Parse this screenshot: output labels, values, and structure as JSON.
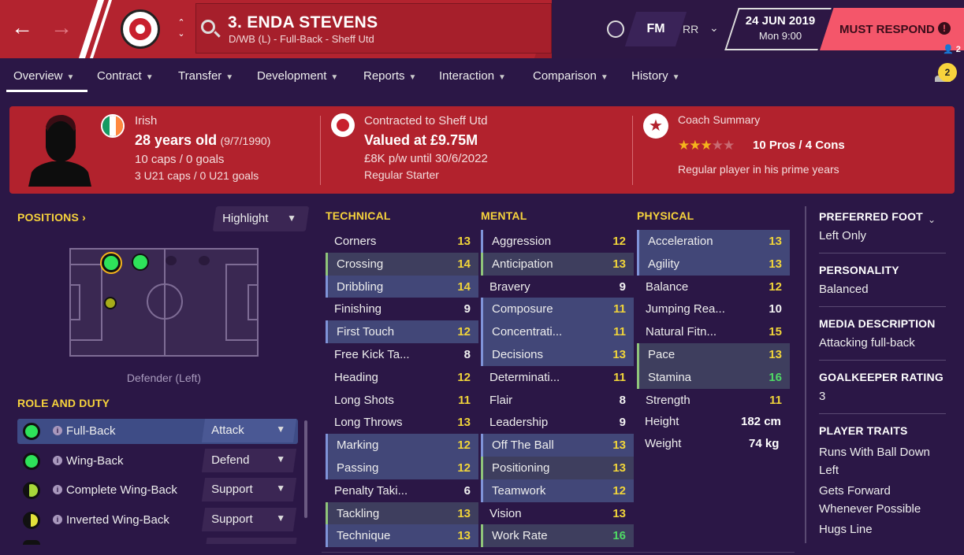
{
  "header": {
    "player_title": "3. ENDA STEVENS",
    "player_subtitle": "D/WB (L) - Full-Back - Sheff Utd",
    "fm_logo": "FM",
    "user_initials": "RR",
    "date": "24 JUN 2019",
    "time": "Mon 9:00",
    "must_respond": "MUST RESPOND",
    "must_respond_icon": "!",
    "user_count": "2",
    "notifications": "2"
  },
  "tabs": [
    "Overview",
    "Contract",
    "Transfer",
    "Development",
    "Reports",
    "Interaction",
    "Comparison",
    "History"
  ],
  "summary": {
    "nationality": "Irish",
    "age": "28 years old",
    "dob": "(9/7/1990)",
    "caps": "10 caps / 0 goals",
    "u21_caps": "3 U21 caps / 0 U21 goals",
    "contract_label": "Contracted to Sheff Utd",
    "value": "Valued at £9.75M",
    "wage": "£8K p/w until 30/6/2022",
    "status": "Regular Starter",
    "coach_label": "Coach Summary",
    "stars": 3,
    "stars_max": 5,
    "pros_cons": "10 Pros / 4 Cons",
    "coach_note": "Regular player in his prime years"
  },
  "positions": {
    "heading": "POSITIONS",
    "highlight_label": "Highlight",
    "position_label": "Defender (Left)"
  },
  "roles": {
    "heading": "ROLE AND DUTY",
    "items": [
      {
        "name": "Full-Back",
        "duty": "Attack",
        "selected": true
      },
      {
        "name": "Wing-Back",
        "duty": "Defend",
        "selected": false
      },
      {
        "name": "Complete Wing-Back",
        "duty": "Support",
        "selected": false
      },
      {
        "name": "Inverted Wing-Back",
        "duty": "Support",
        "selected": false
      }
    ]
  },
  "technical": {
    "heading": "TECHNICAL",
    "attrs": [
      {
        "name": "Corners",
        "value": "13"
      },
      {
        "name": "Crossing",
        "value": "14"
      },
      {
        "name": "Dribbling",
        "value": "14"
      },
      {
        "name": "Finishing",
        "value": "9"
      },
      {
        "name": "First Touch",
        "value": "12"
      },
      {
        "name": "Free Kick Ta...",
        "value": "8"
      },
      {
        "name": "Heading",
        "value": "12"
      },
      {
        "name": "Long Shots",
        "value": "11"
      },
      {
        "name": "Long Throws",
        "value": "13"
      },
      {
        "name": "Marking",
        "value": "12"
      },
      {
        "name": "Passing",
        "value": "12"
      },
      {
        "name": "Penalty Taki...",
        "value": "6"
      },
      {
        "name": "Tackling",
        "value": "13"
      },
      {
        "name": "Technique",
        "value": "13"
      }
    ]
  },
  "mental": {
    "heading": "MENTAL",
    "attrs": [
      {
        "name": "Aggression",
        "value": "12"
      },
      {
        "name": "Anticipation",
        "value": "13"
      },
      {
        "name": "Bravery",
        "value": "9"
      },
      {
        "name": "Composure",
        "value": "11"
      },
      {
        "name": "Concentrati...",
        "value": "11"
      },
      {
        "name": "Decisions",
        "value": "13"
      },
      {
        "name": "Determinati...",
        "value": "11"
      },
      {
        "name": "Flair",
        "value": "8"
      },
      {
        "name": "Leadership",
        "value": "9"
      },
      {
        "name": "Off The Ball",
        "value": "13"
      },
      {
        "name": "Positioning",
        "value": "13"
      },
      {
        "name": "Teamwork",
        "value": "12"
      },
      {
        "name": "Vision",
        "value": "13"
      },
      {
        "name": "Work Rate",
        "value": "16"
      }
    ]
  },
  "physical": {
    "heading": "PHYSICAL",
    "attrs": [
      {
        "name": "Acceleration",
        "value": "13"
      },
      {
        "name": "Agility",
        "value": "13"
      },
      {
        "name": "Balance",
        "value": "12"
      },
      {
        "name": "Jumping Rea...",
        "value": "10"
      },
      {
        "name": "Natural Fitn...",
        "value": "15"
      },
      {
        "name": "Pace",
        "value": "13"
      },
      {
        "name": "Stamina",
        "value": "16"
      },
      {
        "name": "Strength",
        "value": "11"
      }
    ],
    "height_label": "Height",
    "height": "182 cm",
    "weight_label": "Weight",
    "weight": "74 kg"
  },
  "info": {
    "preferred_foot_h": "PREFERRED FOOT",
    "preferred_foot": "Left Only",
    "personality_h": "PERSONALITY",
    "personality": "Balanced",
    "media_h": "MEDIA DESCRIPTION",
    "media": "Attacking full-back",
    "gk_h": "GOALKEEPER RATING",
    "gk": "3",
    "traits_h": "PLAYER TRAITS",
    "traits": [
      "Runs With Ball Down Left",
      "Gets Forward Whenever Possible",
      "Hugs Line"
    ]
  },
  "colors": {
    "header_red": "#b3232f",
    "background": "#2b1746",
    "accent_yellow": "#f0d43a",
    "high_green": "#4fda65",
    "respond_pink": "#f4566a"
  }
}
